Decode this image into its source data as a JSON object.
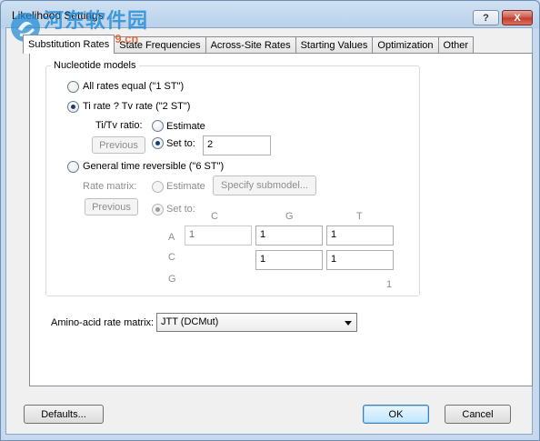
{
  "window": {
    "title": "Likelihood Settings",
    "help_label": "?",
    "close_label": "X"
  },
  "watermark": {
    "line1": "河东软件园",
    "line2": "www.pc0359.cn"
  },
  "tabs": [
    {
      "label": "Substitution Rates",
      "active": true
    },
    {
      "label": "State Frequencies",
      "active": false
    },
    {
      "label": "Across-Site Rates",
      "active": false
    },
    {
      "label": "Starting Values",
      "active": false
    },
    {
      "label": "Optimization",
      "active": false
    },
    {
      "label": "Other",
      "active": false
    }
  ],
  "nucleotide": {
    "group_label": "Nucleotide models",
    "opt_1st": "All rates equal (\"1 ST\")",
    "opt_2st": "Ti rate ? Tv rate (\"2 ST\")",
    "opt_6st": "General time reversible (\"6 ST\")",
    "selected": "2st",
    "titv": {
      "label": "Ti/Tv ratio:",
      "estimate_label": "Estimate",
      "setto_label": "Set to:",
      "value": "2",
      "previous_label": "Previous"
    },
    "rate_matrix": {
      "label": "Rate matrix:",
      "estimate_label": "Estimate",
      "specify_label": "Specify submodel...",
      "setto_label": "Set to:",
      "previous_label": "Previous",
      "col_headers": [
        "C",
        "G",
        "T"
      ],
      "row_headers": [
        "A",
        "C",
        "G"
      ],
      "cells": {
        "AC": "1",
        "AG": "1",
        "AT": "1",
        "CG": "1",
        "CT": "1",
        "GT": "1"
      }
    }
  },
  "amino": {
    "label": "Amino-acid rate matrix:",
    "value": "JTT (DCMut)"
  },
  "buttons": {
    "defaults": "Defaults...",
    "ok": "OK",
    "cancel": "Cancel"
  },
  "colors": {
    "title_bg": "#b9d1ea",
    "close_bg": "#c75a4c",
    "accent": "#3c7fb1"
  }
}
